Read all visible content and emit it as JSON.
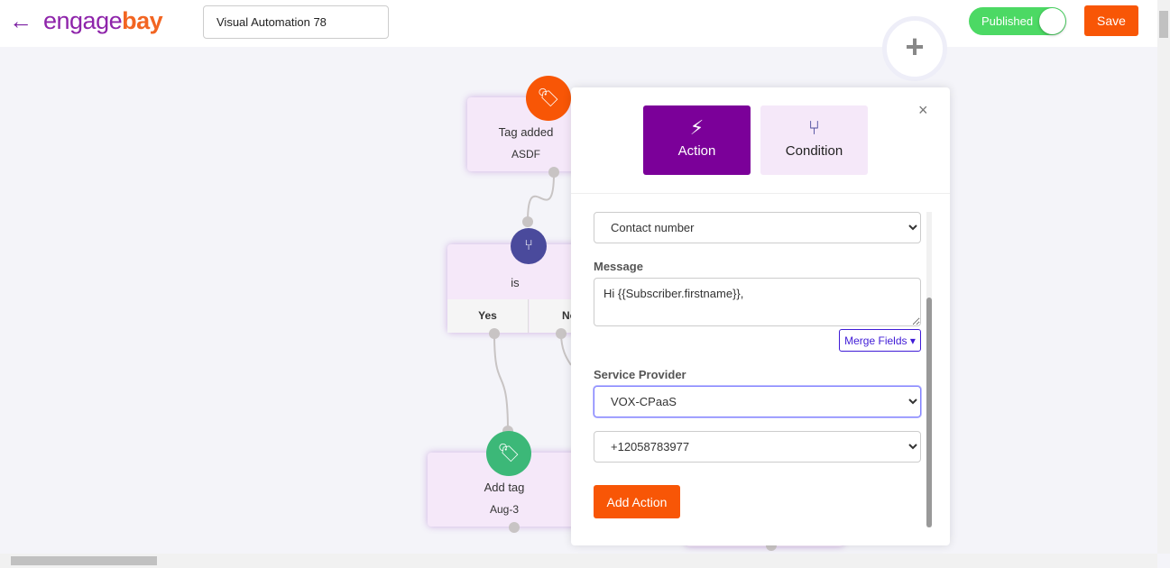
{
  "header": {
    "back_icon": "arrow-left-icon",
    "logo_part1": "engage",
    "logo_part2": "bay",
    "automation_name": "Visual Automation 78",
    "status_label": "Published",
    "status_on": true,
    "save_label": "Save"
  },
  "canvas": {
    "trigger_node": {
      "icon": "tag-icon",
      "title": "Tag added",
      "subtitle": "ASDF",
      "color": "#f85606"
    },
    "condition_node": {
      "icon": "branch-icon",
      "title": "is",
      "yes_label": "Yes",
      "no_label": "No",
      "color": "#4a4a9c"
    },
    "action_node": {
      "icon": "tag-icon",
      "title": "Add tag",
      "subtitle": "Aug-3",
      "color": "#3cb878"
    },
    "add_button_icon": "plus-icon"
  },
  "panel": {
    "tabs": [
      {
        "label": "Action",
        "icon": "bolt-icon",
        "active": true
      },
      {
        "label": "Condition",
        "icon": "branch-icon",
        "active": false
      }
    ],
    "close_icon": "close-icon",
    "contact_field": "Contact number",
    "message_label": "Message",
    "message_value": "Hi {{Subscriber.firstname}},",
    "merge_fields_label": "Merge Fields",
    "provider_label": "Service Provider",
    "provider_value": "VOX-CPaaS",
    "number_value": "+12058783977",
    "add_action_label": "Add Action"
  },
  "colors": {
    "brand_purple": "#7b0099",
    "accent_orange": "#f85606",
    "toggle_green": "#4cd964"
  }
}
